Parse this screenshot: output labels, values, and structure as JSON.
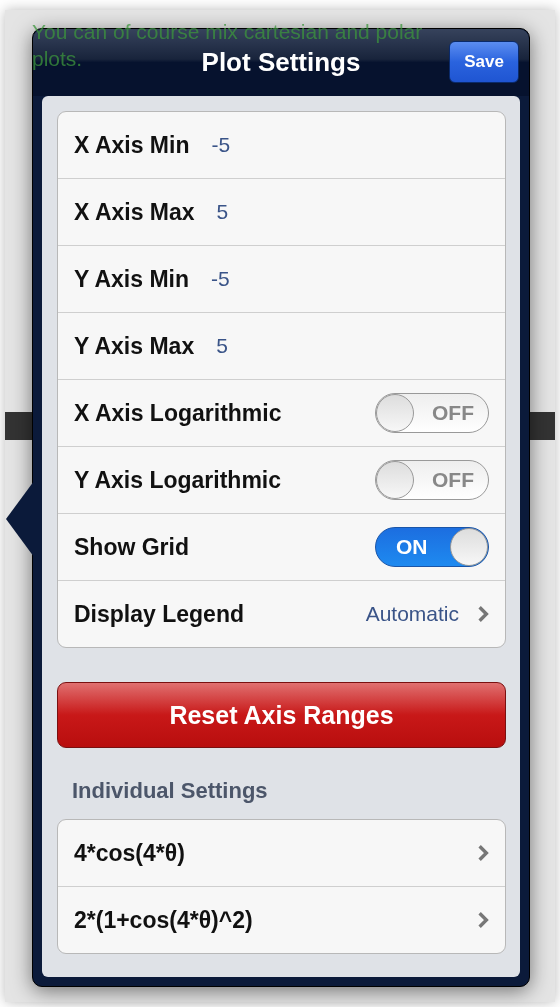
{
  "background_text_lines": [
    "You can of course mix cartesian and polar",
    "plots."
  ],
  "popover": {
    "title": "Plot Settings",
    "save_button": "Save"
  },
  "settings": [
    {
      "kind": "value",
      "label": "X Axis Min",
      "value": "-5"
    },
    {
      "kind": "value",
      "label": "X Axis Max",
      "value": "5"
    },
    {
      "kind": "value",
      "label": "Y Axis Min",
      "value": "-5"
    },
    {
      "kind": "value",
      "label": "Y Axis Max",
      "value": "5"
    },
    {
      "kind": "switch",
      "label": "X Axis Logarithmic",
      "on": false,
      "switch_text": "OFF"
    },
    {
      "kind": "switch",
      "label": "Y Axis Logarithmic",
      "on": false,
      "switch_text": "OFF"
    },
    {
      "kind": "switch",
      "label": "Show Grid",
      "on": true,
      "switch_text": "ON"
    },
    {
      "kind": "disclosure",
      "label": "Display Legend",
      "value": "Automatic"
    }
  ],
  "reset_button": "Reset Axis Ranges",
  "individual_settings": {
    "header": "Individual Settings",
    "items": [
      {
        "label": "4*cos(4*θ)"
      },
      {
        "label": "2*(1+cos(4*θ)^2)"
      }
    ]
  }
}
